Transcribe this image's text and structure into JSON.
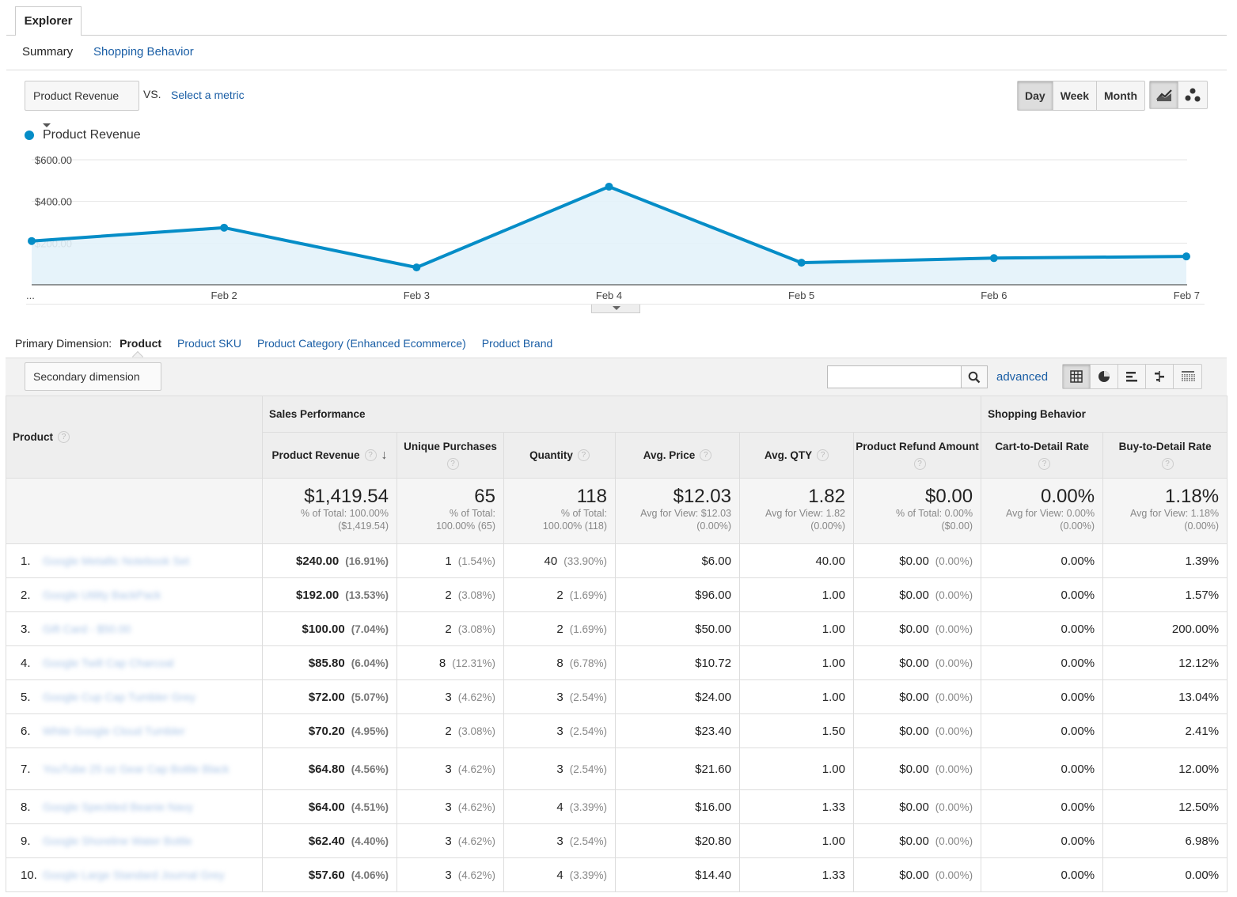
{
  "tabs": {
    "explorer": "Explorer"
  },
  "subtabs": {
    "summary": "Summary",
    "shopping": "Shopping Behavior"
  },
  "metric": {
    "selected": "Product Revenue",
    "vs": "VS.",
    "select_metric": "Select a metric"
  },
  "period": {
    "day": "Day",
    "week": "Week",
    "month": "Month",
    "active": "day"
  },
  "chart_icons": [
    "line-chart-icon",
    "motion-chart-icon"
  ],
  "chart_data": {
    "type": "area",
    "series": [
      {
        "name": "Product Revenue",
        "values": [
          210,
          274,
          83,
          471,
          106,
          128,
          136
        ]
      }
    ],
    "x": [
      "...",
      "Feb 2",
      "Feb 3",
      "Feb 4",
      "Feb 5",
      "Feb 6",
      "Feb 7"
    ],
    "y_ticks": [
      "$600.00",
      "$400.00",
      "$200.00"
    ],
    "y_tick_values": [
      600,
      400,
      200
    ],
    "ylim": [
      0,
      600
    ],
    "line_color": "#058dc7",
    "fill_color": "#e3f2f9",
    "grid": true
  },
  "primary_dimension": {
    "label": "Primary Dimension:",
    "active": "Product",
    "options": [
      "Product SKU",
      "Product Category (Enhanced Ecommerce)",
      "Product Brand"
    ]
  },
  "toolbar": {
    "secondary_dimension": "Secondary dimension",
    "search_value": "",
    "advanced": "advanced",
    "view_icons": [
      "data-table-icon",
      "pie-chart-icon",
      "performance-icon",
      "comparison-icon",
      "pivot-icon"
    ]
  },
  "table": {
    "groups": {
      "product": "Product",
      "sales": "Sales Performance",
      "shopping": "Shopping Behavior"
    },
    "columns": {
      "revenue": "Product Revenue",
      "unique": "Unique Purchases",
      "quantity": "Quantity",
      "avg_price": "Avg. Price",
      "avg_qty": "Avg. QTY",
      "refund": "Product Refund Amount",
      "cart": "Cart-to-Detail Rate",
      "buy": "Buy-to-Detail Rate"
    },
    "totals": {
      "revenue": {
        "value": "$1,419.54",
        "l1": "% of Total: 100.00%",
        "l2": "($1,419.54)"
      },
      "unique": {
        "value": "65",
        "l1": "% of Total:",
        "l2": "100.00% (65)"
      },
      "quantity": {
        "value": "118",
        "l1": "% of Total:",
        "l2": "100.00% (118)"
      },
      "avg_price": {
        "value": "$12.03",
        "l1": "Avg for View: $12.03",
        "l2": "(0.00%)"
      },
      "avg_qty": {
        "value": "1.82",
        "l1": "Avg for View: 1.82",
        "l2": "(0.00%)"
      },
      "refund": {
        "value": "$0.00",
        "l1": "% of Total: 0.00%",
        "l2": "($0.00)"
      },
      "cart": {
        "value": "0.00%",
        "l1": "Avg for View: 0.00%",
        "l2": "(0.00%)"
      },
      "buy": {
        "value": "1.18%",
        "l1": "Avg for View: 1.18%",
        "l2": "(0.00%)"
      }
    },
    "rows": [
      {
        "n": "1.",
        "product": "Google Metallic Notebook Set",
        "rev": "$240.00",
        "rev_pct": "(16.91%)",
        "uniq": "1",
        "uniq_pct": "(1.54%)",
        "qty": "40",
        "qty_pct": "(33.90%)",
        "price": "$6.00",
        "avgqty": "40.00",
        "refund": "$0.00",
        "refund_pct": "(0.00%)",
        "cart": "0.00%",
        "buy": "1.39%"
      },
      {
        "n": "2.",
        "product": "Google Utility BackPack",
        "rev": "$192.00",
        "rev_pct": "(13.53%)",
        "uniq": "2",
        "uniq_pct": "(3.08%)",
        "qty": "2",
        "qty_pct": "(1.69%)",
        "price": "$96.00",
        "avgqty": "1.00",
        "refund": "$0.00",
        "refund_pct": "(0.00%)",
        "cart": "0.00%",
        "buy": "1.57%"
      },
      {
        "n": "3.",
        "product": "Gift Card - $50.00",
        "rev": "$100.00",
        "rev_pct": "(7.04%)",
        "uniq": "2",
        "uniq_pct": "(3.08%)",
        "qty": "2",
        "qty_pct": "(1.69%)",
        "price": "$50.00",
        "avgqty": "1.00",
        "refund": "$0.00",
        "refund_pct": "(0.00%)",
        "cart": "0.00%",
        "buy": "200.00%"
      },
      {
        "n": "4.",
        "product": "Google Twill Cap Charcoal",
        "rev": "$85.80",
        "rev_pct": "(6.04%)",
        "uniq": "8",
        "uniq_pct": "(12.31%)",
        "qty": "8",
        "qty_pct": "(6.78%)",
        "price": "$10.72",
        "avgqty": "1.00",
        "refund": "$0.00",
        "refund_pct": "(0.00%)",
        "cart": "0.00%",
        "buy": "12.12%"
      },
      {
        "n": "5.",
        "product": "Google Cup Cap Tumbler Grey",
        "rev": "$72.00",
        "rev_pct": "(5.07%)",
        "uniq": "3",
        "uniq_pct": "(4.62%)",
        "qty": "3",
        "qty_pct": "(2.54%)",
        "price": "$24.00",
        "avgqty": "1.00",
        "refund": "$0.00",
        "refund_pct": "(0.00%)",
        "cart": "0.00%",
        "buy": "13.04%"
      },
      {
        "n": "6.",
        "product": "White Google Cloud Tumbler",
        "rev": "$70.20",
        "rev_pct": "(4.95%)",
        "uniq": "2",
        "uniq_pct": "(3.08%)",
        "qty": "3",
        "qty_pct": "(2.54%)",
        "price": "$23.40",
        "avgqty": "1.50",
        "refund": "$0.00",
        "refund_pct": "(0.00%)",
        "cart": "0.00%",
        "buy": "2.41%"
      },
      {
        "n": "7.",
        "product": "YouTube 25 oz Gear Cap Bottle Black",
        "rev": "$64.80",
        "rev_pct": "(4.56%)",
        "uniq": "3",
        "uniq_pct": "(4.62%)",
        "qty": "3",
        "qty_pct": "(2.54%)",
        "price": "$21.60",
        "avgqty": "1.00",
        "refund": "$0.00",
        "refund_pct": "(0.00%)",
        "cart": "0.00%",
        "buy": "12.00%",
        "tall": true
      },
      {
        "n": "8.",
        "product": "Google Speckled Beanie Navy",
        "rev": "$64.00",
        "rev_pct": "(4.51%)",
        "uniq": "3",
        "uniq_pct": "(4.62%)",
        "qty": "4",
        "qty_pct": "(3.39%)",
        "price": "$16.00",
        "avgqty": "1.33",
        "refund": "$0.00",
        "refund_pct": "(0.00%)",
        "cart": "0.00%",
        "buy": "12.50%"
      },
      {
        "n": "9.",
        "product": "Google Shoreline Water Bottle",
        "rev": "$62.40",
        "rev_pct": "(4.40%)",
        "uniq": "3",
        "uniq_pct": "(4.62%)",
        "qty": "3",
        "qty_pct": "(2.54%)",
        "price": "$20.80",
        "avgqty": "1.00",
        "refund": "$0.00",
        "refund_pct": "(0.00%)",
        "cart": "0.00%",
        "buy": "6.98%"
      },
      {
        "n": "10.",
        "product": "Google Large Standard Journal Grey",
        "rev": "$57.60",
        "rev_pct": "(4.06%)",
        "uniq": "3",
        "uniq_pct": "(4.62%)",
        "qty": "4",
        "qty_pct": "(3.39%)",
        "price": "$14.40",
        "avgqty": "1.33",
        "refund": "$0.00",
        "refund_pct": "(0.00%)",
        "cart": "0.00%",
        "buy": "0.00%"
      }
    ]
  }
}
